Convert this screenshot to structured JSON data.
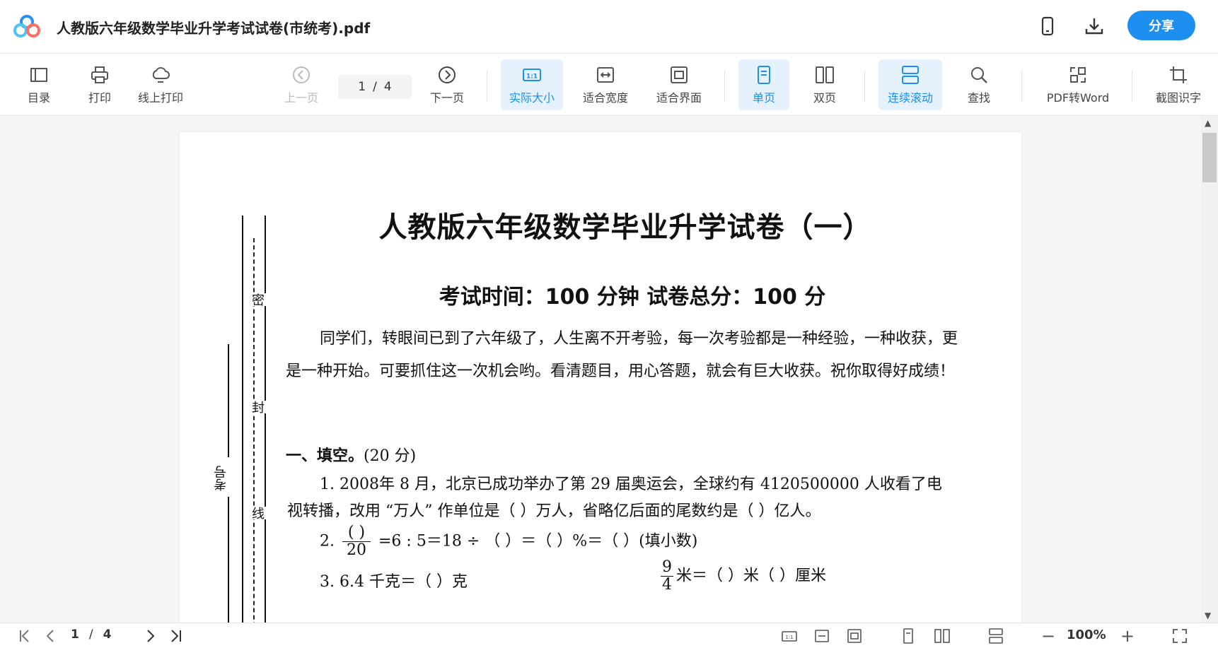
{
  "titlebar": {
    "document_title": "人教版六年级数学毕业升学考试试卷(市统考).pdf",
    "share_label": "分享",
    "icons": [
      "app-logo-icon",
      "phone-icon",
      "download-icon"
    ]
  },
  "toolbar": {
    "toc": "目录",
    "print": "打印",
    "online_print": "线上打印",
    "prev_page": "上一页",
    "current_page": "1",
    "page_sep": "/",
    "total_pages": "4",
    "next_page": "下一页",
    "actual_size": "实际大小",
    "fit_width": "适合宽度",
    "fit_page": "适合界面",
    "single_page": "单页",
    "double_page": "双页",
    "continuous_scroll": "连续滚动",
    "find": "查找",
    "pdf_to_word": "PDF转Word",
    "screenshot_ocr": "截图识字",
    "actual_size_icon_text": "1:1"
  },
  "document": {
    "title": "人教版六年级数学毕业升学试卷（一）",
    "subtitle": "考试时间：100 分钟     试卷总分：100 分",
    "intro": "同学们，转眼间已到了六年级了，人生离不开考验，每一次考验都是一种经验，一种收获，更是一种开始。可要抓住这一次机会哟。看清题目，用心答题，就会有巨大收获。祝你取得好成绩！",
    "section1_head": "一、填空。",
    "section1_points": "(20 分)",
    "q1_line1": "1. 2008年 8 月，北京已成功举办了第 29 届奥运会，全球约有 4120500000 人收看了电",
    "q1_line2": "视转播，改用 “万人” 作单位是（          ）万人，省略亿后面的尾数约是（      ）亿人。",
    "q2_prefix": "2.",
    "q2_frac_num": "(       )",
    "q2_frac_den": "20",
    "q2_rest": "=6 : 5＝18 ÷ （      ）＝（      ）%＝（      ）(填小数)",
    "q3_left": "3. 6.4 千克＝（      ）克",
    "q3_frac_num": "9",
    "q3_frac_den": "4",
    "q3_right": "米＝（      ）米（      ）厘米",
    "margin_chars": [
      "密",
      "封",
      "线"
    ],
    "margin_label": "考号"
  },
  "statusbar": {
    "current_page": "1",
    "page_sep": "/",
    "total_pages": "4",
    "zoom": "100%",
    "zoom_minus": "−",
    "zoom_plus": "+"
  },
  "colors": {
    "accent": "#1d8ff0",
    "active_bg": "#e5f2fe"
  }
}
